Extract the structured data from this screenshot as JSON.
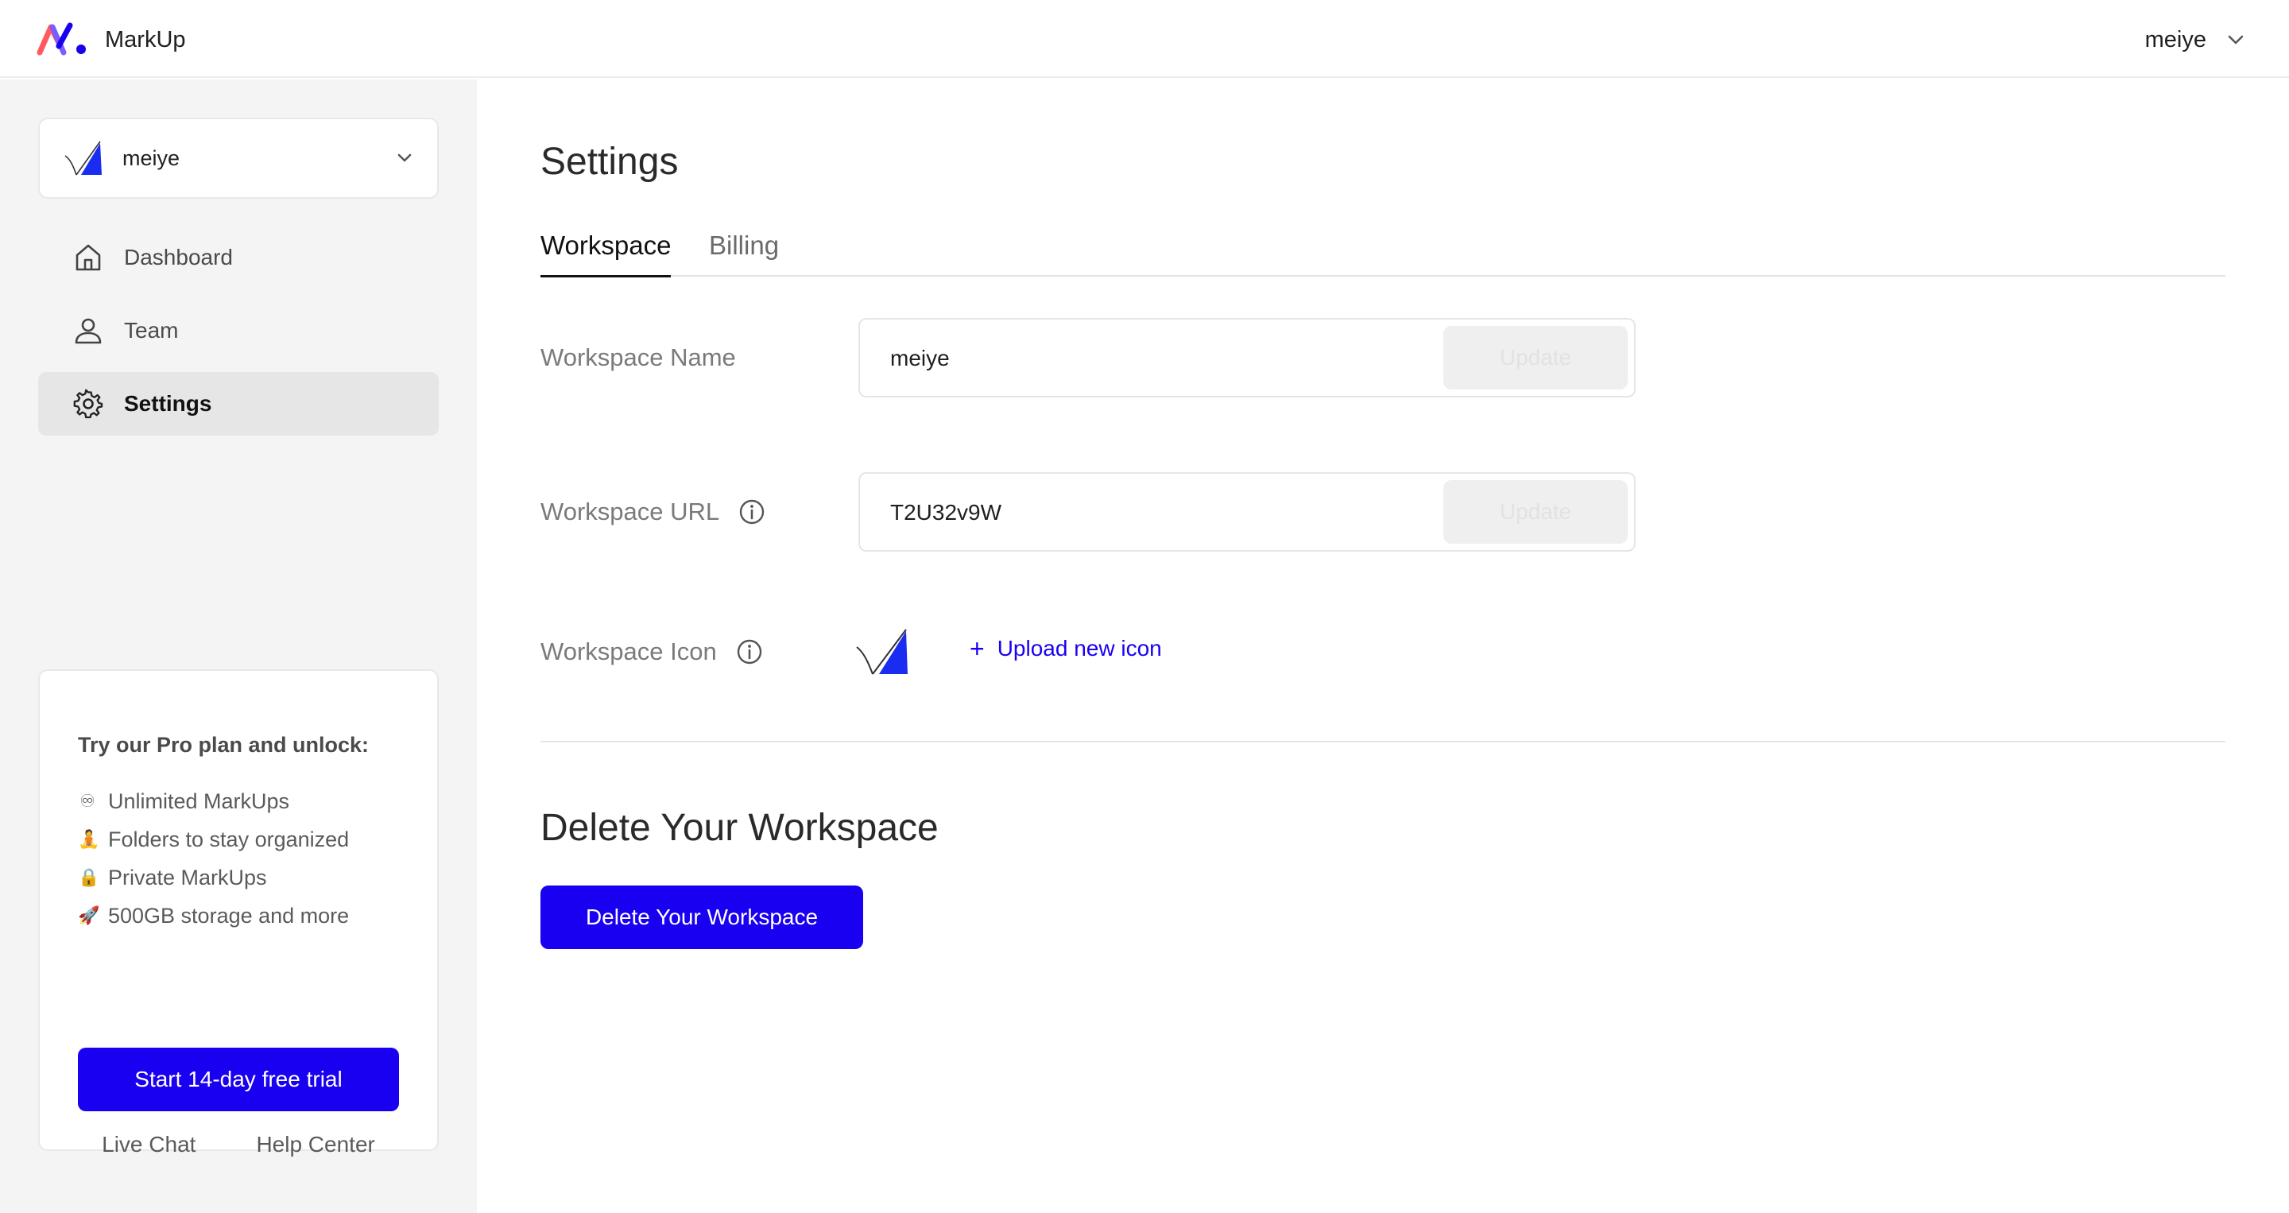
{
  "app": {
    "name": "MarkUp",
    "logo_icon": "markup-logo-icon"
  },
  "header": {
    "user_name": "meiye",
    "user_menu_icon": "chevron-down-icon"
  },
  "sidebar": {
    "workspace_switcher": {
      "label": "meiye",
      "icon": "workspace-logo-icon"
    },
    "nav": [
      {
        "label": "Dashboard",
        "icon": "home-icon",
        "active": false
      },
      {
        "label": "Team",
        "icon": "user-icon",
        "active": false
      },
      {
        "label": "Settings",
        "icon": "gear-icon",
        "active": true
      }
    ],
    "promo": {
      "title": "Try our Pro plan and unlock:",
      "items": [
        {
          "emoji": "♾",
          "text": "Unlimited MarkUps"
        },
        {
          "emoji": "🧘",
          "text": "Folders to stay organized"
        },
        {
          "emoji": "🔒",
          "text": "Private MarkUps"
        },
        {
          "emoji": "🚀",
          "text": "500GB storage and more"
        }
      ],
      "cta": "Start 14-day free trial"
    },
    "footer": {
      "live_chat": "Live Chat",
      "help_center": "Help Center"
    }
  },
  "main": {
    "title": "Settings",
    "tabs": [
      {
        "label": "Workspace",
        "active": true
      },
      {
        "label": "Billing",
        "active": false
      }
    ],
    "workspace_name": {
      "label": "Workspace Name",
      "value": "meiye",
      "button": "Update"
    },
    "workspace_url": {
      "label": "Workspace URL",
      "value": "T2U32v9W",
      "button": "Update"
    },
    "workspace_icon": {
      "label": "Workspace Icon",
      "upload_label": "Upload new icon"
    },
    "delete": {
      "title": "Delete Your Workspace",
      "button": "Delete Your Workspace"
    }
  },
  "colors": {
    "accent": "#1a00f0",
    "sidebar_bg": "#f4f4f4",
    "active_nav_bg": "#e6e6e6"
  }
}
